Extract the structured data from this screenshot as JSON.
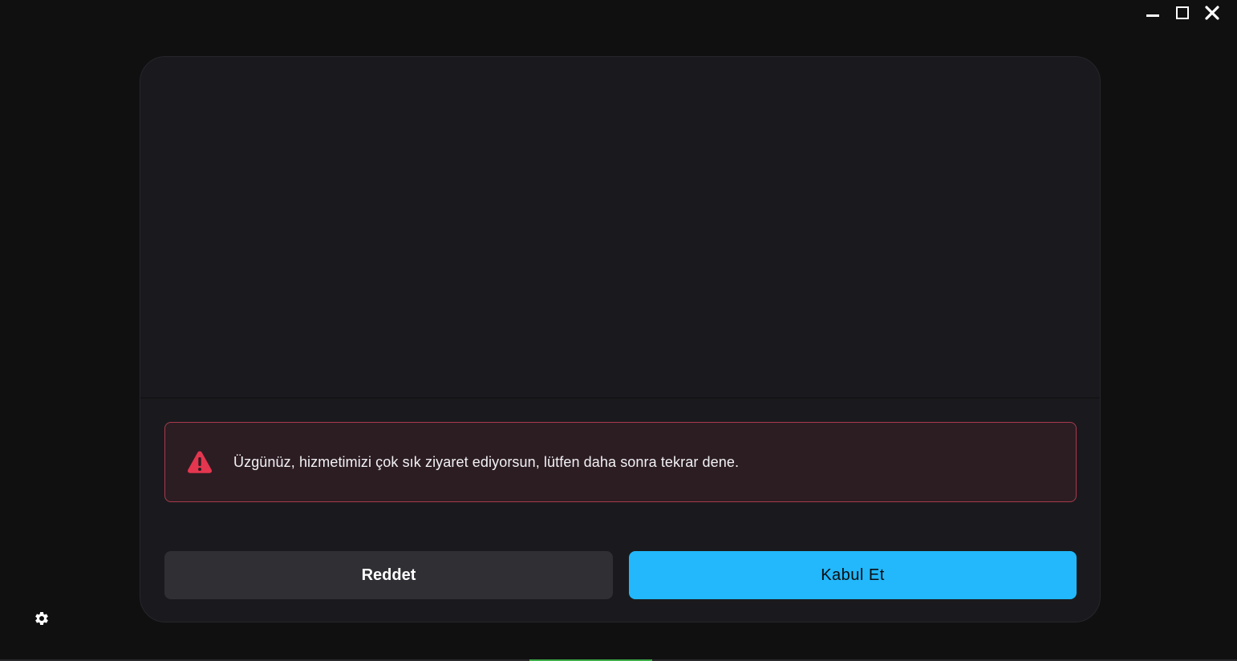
{
  "window_controls": {
    "minimize_icon": "minimize-icon",
    "maximize_icon": "maximize-icon",
    "close_icon": "close-icon"
  },
  "alert": {
    "icon": "warning-triangle-icon",
    "message": "Üzgünüz, hizmetimizi çok sık ziyaret ediyorsun, lütfen daha sonra tekrar dene.",
    "color": "#e5364f"
  },
  "buttons": {
    "reject_label": "Reddet",
    "accept_label": "Kabul Et",
    "accept_color": "#22b8fb"
  },
  "settings": {
    "icon": "gear-icon"
  }
}
